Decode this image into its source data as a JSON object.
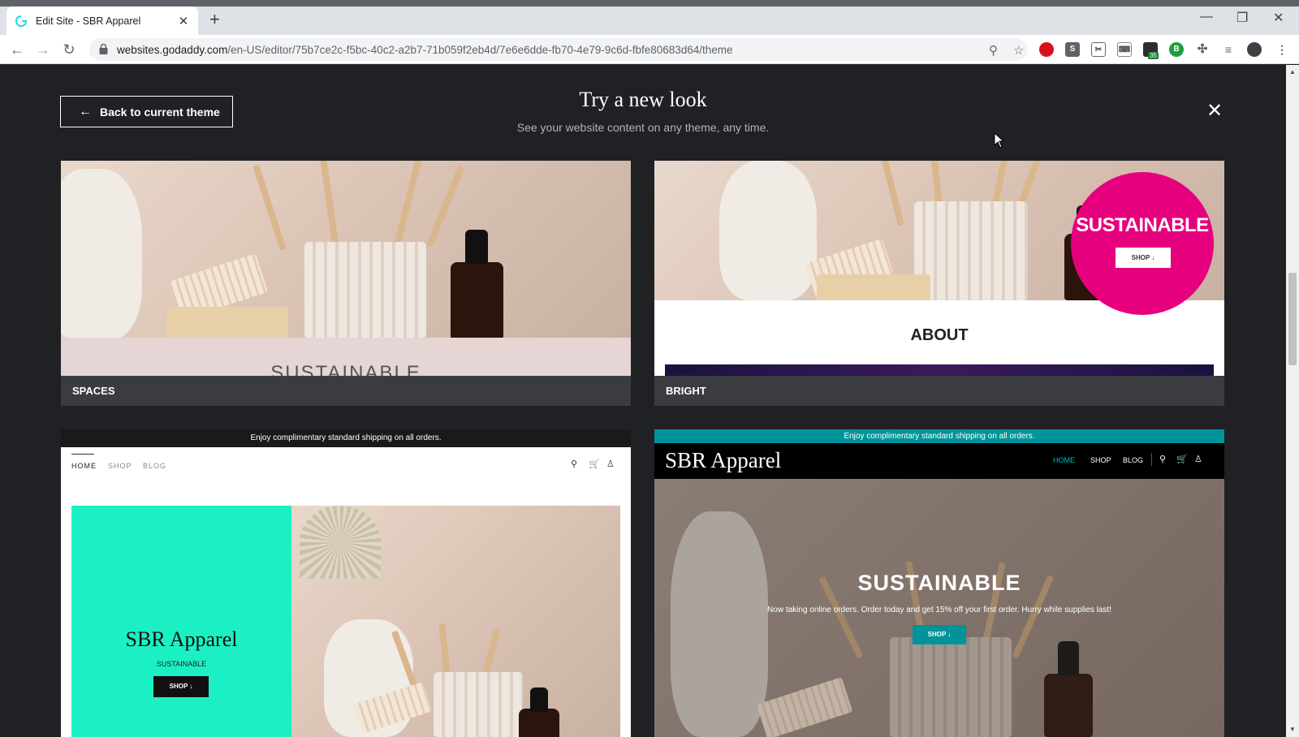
{
  "browser": {
    "tab_title": "Edit Site - SBR Apparel",
    "url_host": "websites.godaddy.com",
    "url_path": "/en-US/editor/75b7ce2c-f5bc-40c2-a2b7-71b059f2eb4d/7e6e6dde-fb70-4e79-9c6d-fbfe80683d64/theme",
    "ext_badge": "35"
  },
  "header": {
    "back_label": "Back to current theme",
    "title": "Try a new look",
    "subtitle": "See your website content on any theme, any time."
  },
  "themes": [
    {
      "name": "SPACES",
      "hero_text": "SUSTAINABLE"
    },
    {
      "name": "BRIGHT",
      "circle_title": "SUSTAINABLE",
      "shop_label": "SHOP ↓",
      "section_title": "ABOUT"
    },
    {
      "banner": "Enjoy complimentary standard shipping on all orders.",
      "nav": [
        "HOME",
        "SHOP",
        "BLOG"
      ],
      "site_title": "SBR Apparel",
      "tagline": "SUSTAINABLE",
      "shop_label": "SHOP ↓"
    },
    {
      "banner": "Enjoy complimentary standard shipping on all orders.",
      "nav": [
        "HOME",
        "SHOP",
        "BLOG"
      ],
      "site_title": "SBR Apparel",
      "hero_title": "SUSTAINABLE",
      "hero_text": "Now taking online orders. Order today and get 15% off your first order. Hurry while supplies last!",
      "shop_label": "SHOP ↓"
    }
  ],
  "colors": {
    "bright_pink": "#e6007e",
    "mint": "#1bf0c4",
    "teal": "#00949a",
    "background": "#202124"
  }
}
